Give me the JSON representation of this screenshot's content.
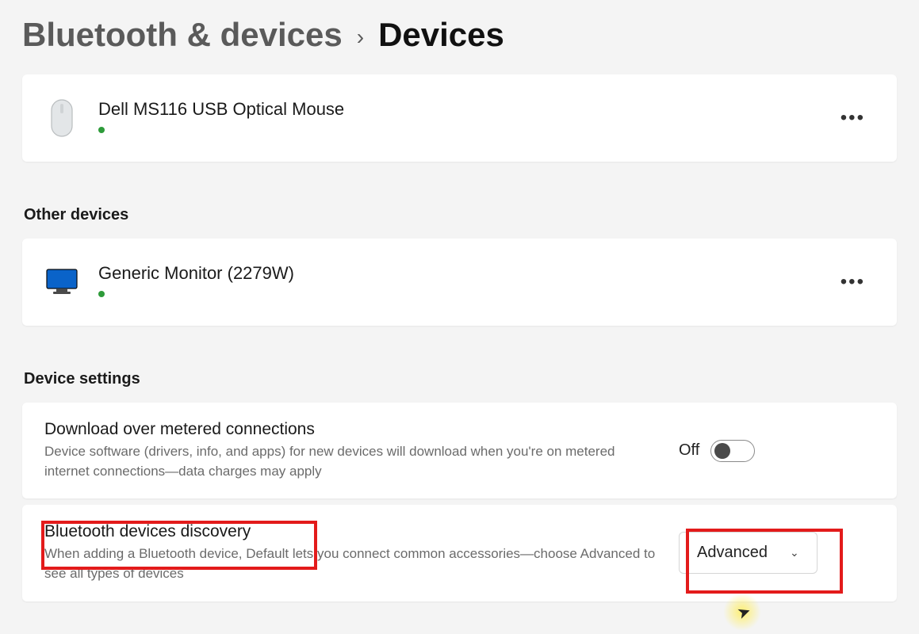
{
  "breadcrumb": {
    "parent": "Bluetooth & devices",
    "current": "Devices"
  },
  "devices": {
    "mouse": {
      "name": "Dell MS116 USB Optical Mouse",
      "status_color": "#2e9b3a"
    }
  },
  "sections": {
    "other": "Other devices",
    "settings": "Device settings"
  },
  "other_devices": {
    "monitor": {
      "name": "Generic Monitor (2279W)",
      "status_color": "#2e9b3a"
    }
  },
  "settings": {
    "metered": {
      "title": "Download over metered connections",
      "desc": "Device software (drivers, info, and apps) for new devices will download when you're on metered internet connections—data charges may apply",
      "toggle_label": "Off"
    },
    "discovery": {
      "title": "Bluetooth devices discovery",
      "desc": "When adding a Bluetooth device, Default lets you connect common accessories—choose Advanced to see all types of devices",
      "select_value": "Advanced"
    }
  },
  "more_glyph": "•••"
}
